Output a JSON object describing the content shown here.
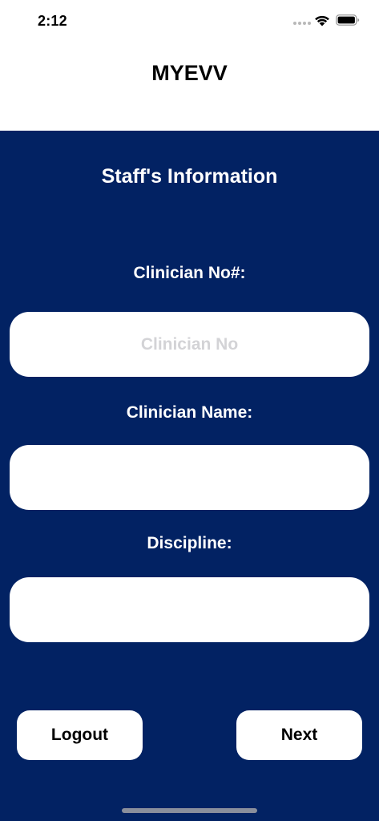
{
  "status_bar": {
    "time": "2:12",
    "icons": [
      "cellular-signal-icon",
      "wifi-icon",
      "battery-icon"
    ]
  },
  "header": {
    "title": "MYEVV"
  },
  "form": {
    "section_title": "Staff's Information",
    "fields": [
      {
        "label": "Clinician No#:",
        "value": "",
        "placeholder": "Clinician No"
      },
      {
        "label": "Clinician Name:",
        "value": "",
        "placeholder": ""
      },
      {
        "label": "Discipline:",
        "value": "",
        "placeholder": ""
      }
    ]
  },
  "actions": {
    "logout_label": "Logout",
    "next_label": "Next"
  },
  "colors": {
    "panel_background": "#022263",
    "header_background": "#ffffff",
    "input_background": "#ffffff",
    "placeholder_text": "#d3d3d6"
  }
}
